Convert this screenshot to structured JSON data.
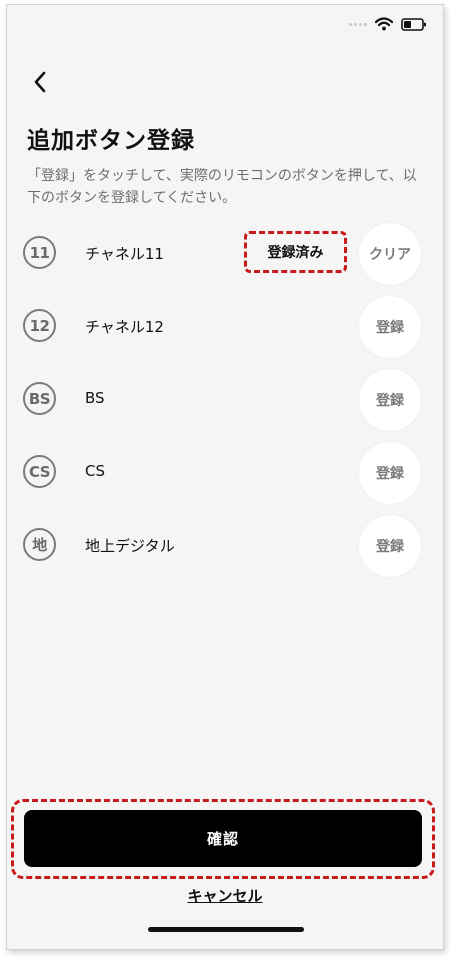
{
  "header": {
    "title": "追加ボタン登録",
    "description": "「登録」をタッチして、実際のリモコンのボタンを押して、以下のボタンを登録してください。"
  },
  "channels": [
    {
      "icon_label": "11",
      "name": "チャネル11",
      "status": "登録済み",
      "button_label": "クリア"
    },
    {
      "icon_label": "12",
      "name": "チャネル12",
      "button_label": "登録"
    },
    {
      "icon_label": "BS",
      "name": "BS",
      "button_label": "登録"
    },
    {
      "icon_label": "CS",
      "name": "CS",
      "button_label": "登録"
    },
    {
      "icon_label": "地",
      "name": "地上デジタル",
      "button_label": "登録"
    }
  ],
  "footer": {
    "confirm_label": "確認",
    "cancel_label": "キャンセル"
  },
  "icons": {
    "back": "chevron-left-icon",
    "wifi": "wifi-icon",
    "battery": "battery-icon"
  },
  "colors": {
    "highlight": "#c81a1a",
    "primary_button": "#000000",
    "background": "#f5f5f5"
  }
}
